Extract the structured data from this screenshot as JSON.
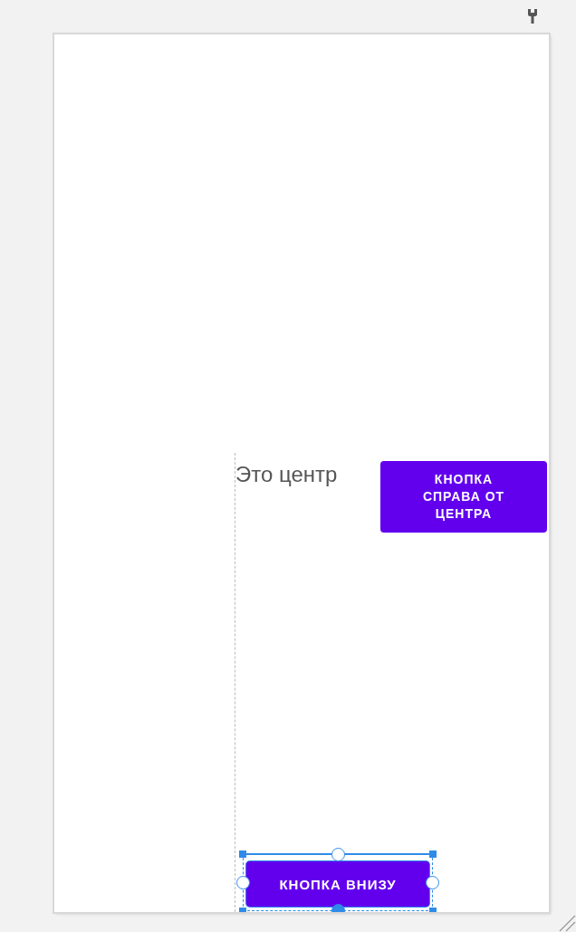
{
  "canvas": {
    "label": "Это центр",
    "buttons": [
      {
        "kind": "center-right",
        "text": "КНОПКА СПРАВА ОТ ЦЕНТРА",
        "selected": false
      },
      {
        "kind": "bottom",
        "text": "КНОПКА ВНИЗУ",
        "selected": true
      }
    ]
  }
}
